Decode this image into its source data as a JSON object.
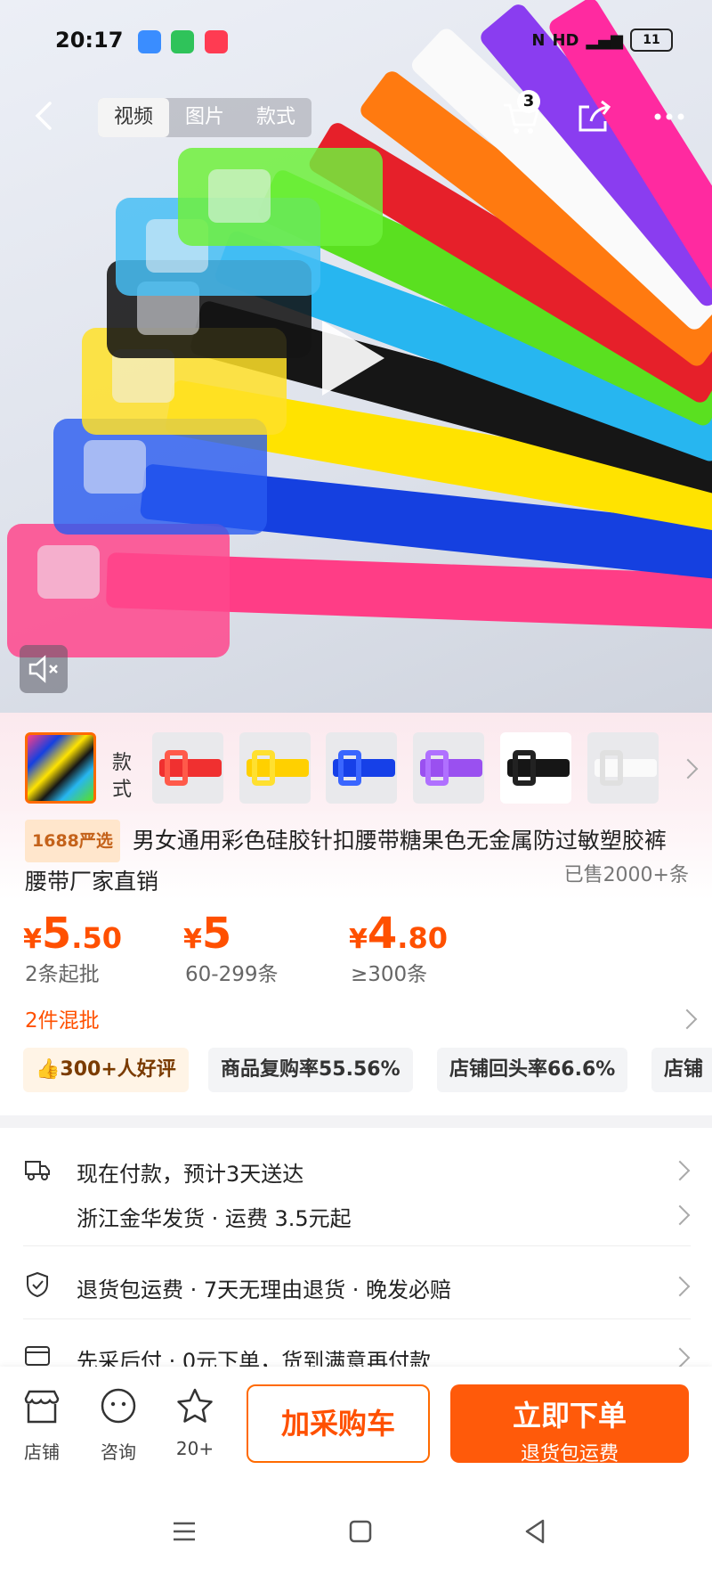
{
  "status_bar": {
    "time": "20:17",
    "battery": "11"
  },
  "nav": {
    "tabs": [
      "视频",
      "图片",
      "款式"
    ],
    "cart_count": "3"
  },
  "thumbnails": {
    "style_label": "款式"
  },
  "product": {
    "tag": "1688严选",
    "title": "男女通用彩色硅胶针扣腰带糖果色无金属防过敏塑胶裤腰带厂家直销",
    "sold": "已售2000+条"
  },
  "prices": [
    {
      "cur": "¥",
      "int": "5",
      "dec": ".50",
      "tier": "2条起批"
    },
    {
      "cur": "¥",
      "int": "5",
      "dec": "",
      "tier": "60-299条"
    },
    {
      "cur": "¥",
      "int": "4",
      "dec": ".80",
      "tier": "≥300条"
    }
  ],
  "mixed_batch": "2件混批",
  "badges": [
    "300+人好评",
    "商品复购率55.56%",
    "店铺回头率66.6%",
    "店铺"
  ],
  "service_rows": {
    "shipping_time": "现在付款，预计3天送达",
    "shipping_from": "浙江金华发货 · 运费 3.5元起",
    "guarantee": "退货包运费 · 7天无理由退货 · 晚发必赔",
    "pay_later": "先采后付 · 0元下单，货到满意再付款"
  },
  "bottom_bar": {
    "shop": "店铺",
    "consult": "咨询",
    "favorites": "20+",
    "add_cart": "加采购车",
    "buy_now": "立即下单",
    "buy_sub": "退货包运费"
  },
  "colors": {
    "accent": "#ff5000",
    "button": "#ff5a0a"
  }
}
